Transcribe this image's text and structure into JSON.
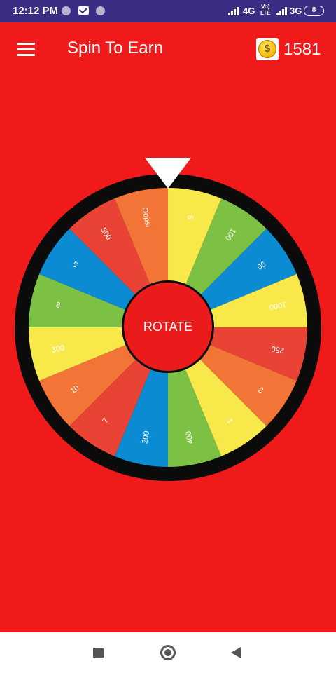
{
  "status_bar": {
    "time": "12:12 PM",
    "net1": "4G",
    "volte_top": "Vo)",
    "volte_bottom": "LTE",
    "net2": "3G",
    "battery": "8"
  },
  "app_bar": {
    "title": "Spin To Earn",
    "coin_symbol": "$",
    "coins": "1581"
  },
  "wheel": {
    "center_button": "ROTATE",
    "segments": [
      {
        "label": "5",
        "color": "#f9e84a"
      },
      {
        "label": "100",
        "color": "#7cc044"
      },
      {
        "label": "90",
        "color": "#0b8bd1"
      },
      {
        "label": "1000",
        "color": "#f9e84a"
      },
      {
        "label": "250",
        "color": "#e84335"
      },
      {
        "label": "3",
        "color": "#f27436"
      },
      {
        "label": "1",
        "color": "#f9e84a"
      },
      {
        "label": "400",
        "color": "#7cc044"
      },
      {
        "label": "200",
        "color": "#0b8bd1"
      },
      {
        "label": "7",
        "color": "#e84335"
      },
      {
        "label": "10",
        "color": "#f27436"
      },
      {
        "label": "300",
        "color": "#f9e84a"
      },
      {
        "label": "8",
        "color": "#7cc044"
      },
      {
        "label": "5",
        "color": "#0b8bd1"
      },
      {
        "label": "500",
        "color": "#e84335"
      },
      {
        "label": "Oops!",
        "color": "#f27436"
      }
    ]
  },
  "colors": {
    "background": "#f01a1a",
    "status_bar": "#3a2e84",
    "wheel_rim": "#0b0b0b"
  }
}
